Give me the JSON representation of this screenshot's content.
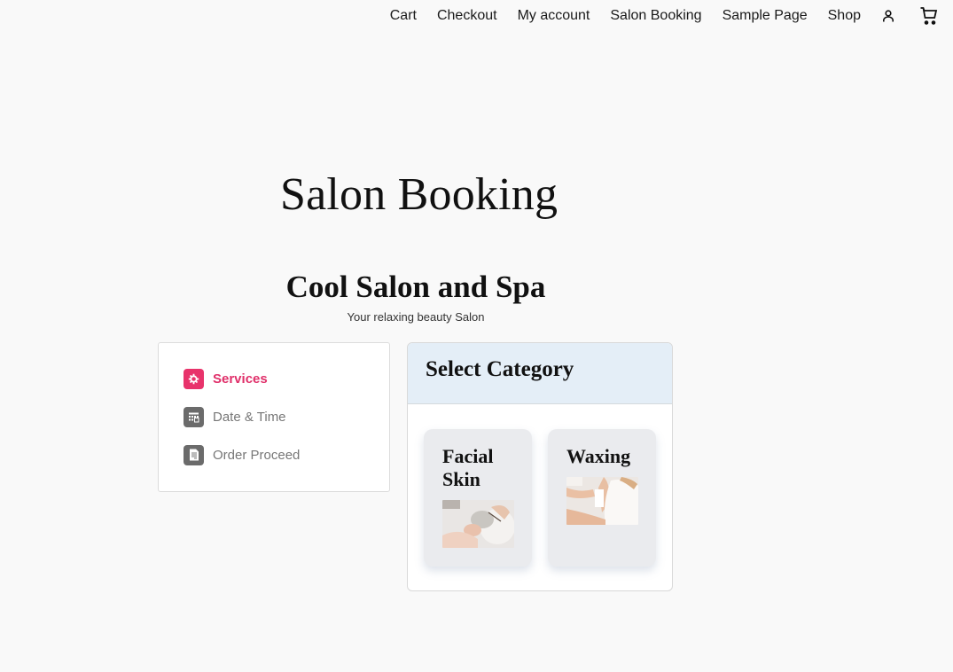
{
  "nav": {
    "links": [
      "Cart",
      "Checkout",
      "My account",
      "Salon Booking",
      "Sample Page",
      "Shop"
    ],
    "icons": [
      "user-icon",
      "cart-icon"
    ]
  },
  "page": {
    "title": "Salon Booking"
  },
  "salon": {
    "name": "Cool Salon and Spa",
    "tagline": "Your relaxing beauty Salon"
  },
  "steps": [
    {
      "label": "Services",
      "icon": "services-icon",
      "active": true
    },
    {
      "label": "Date & Time",
      "icon": "calendar-icon",
      "active": false
    },
    {
      "label": "Order Proceed",
      "icon": "document-icon",
      "active": false
    }
  ],
  "category": {
    "header": "Select Category",
    "items": [
      {
        "title": "Facial Skin",
        "image": "facial-skin-photo"
      },
      {
        "title": "Waxing",
        "image": "waxing-photo"
      }
    ]
  },
  "colors": {
    "accent": "#e8336b",
    "header_bg": "#e4eef7",
    "inactive_icon": "#6b6b6b"
  }
}
